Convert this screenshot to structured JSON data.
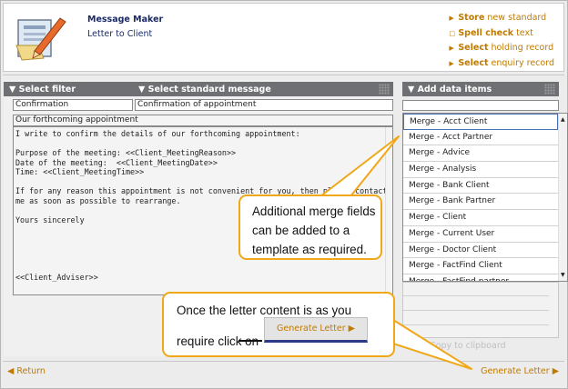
{
  "header": {
    "title": "Message Maker",
    "subtitle": "Letter to Client",
    "links": [
      {
        "bold": "Store",
        "rest": " new standard"
      },
      {
        "bold": "Spell check",
        "rest": " text"
      },
      {
        "bold": "Select",
        "rest": " holding record"
      },
      {
        "bold": "Select",
        "rest": " enquiry record"
      }
    ]
  },
  "filters": {
    "filter_label": "Select filter",
    "standard_label": "Select standard message",
    "filter_value": "Confirmation",
    "standard_value": "Confirmation of appointment"
  },
  "letter": {
    "subject": "Our forthcoming appointment",
    "body": "I write to confirm the details of our forthcoming appointment:\n\nPurpose of the meeting: <<Client_MeetingReason>>\nDate of the meeting:  <<Client_MeetingDate>>\nTime: <<Client_MeetingTime>>\n\nIf for any reason this appointment is not convenient for you, then please contact\nme as soon as possible to rearrange.\n\nYours sincerely\n\n\n\n\n\n<<Client_Adviser>>"
  },
  "data_items": {
    "label": "Add data items",
    "options": [
      "Merge - Acct Client",
      "Merge - Acct Partner",
      "Merge - Advice",
      "Merge - Analysis",
      "Merge - Bank Client",
      "Merge - Bank Partner",
      "Merge - Client",
      "Merge - Current User",
      "Merge - Doctor Client",
      "Merge - FactFind Client",
      "Merge - FactFind partner"
    ],
    "copy_label": "Copy to clipboard"
  },
  "footer": {
    "return_label": "Return",
    "generate_label": "Generate Letter"
  },
  "callouts": {
    "merge_text": [
      "Additional merge fields",
      "can be added to a",
      "template as required."
    ],
    "generate_line1": "Once the letter content is as you",
    "generate_line2": "require click on",
    "generate_button": "Generate Letter"
  },
  "colors": {
    "accent": "#c07a00",
    "bar": "#6e7074",
    "callout_border": "#f0a818"
  }
}
